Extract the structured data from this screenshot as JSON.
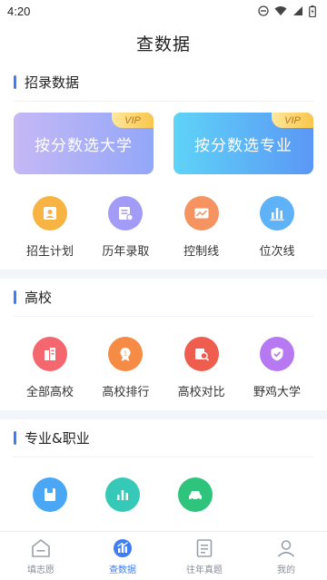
{
  "status_bar": {
    "time": "4:20"
  },
  "header": {
    "title": "查数据"
  },
  "sections": [
    {
      "title": "招录数据",
      "vip_cards": [
        {
          "label": "按分数选大学",
          "badge": "VIP"
        },
        {
          "label": "按分数选专业",
          "badge": "VIP"
        }
      ],
      "items": [
        {
          "label": "招生计划",
          "icon": "admission-plan-icon",
          "color": "#f8b443"
        },
        {
          "label": "历年录取",
          "icon": "admission-history-icon",
          "color": "#a39cf6"
        },
        {
          "label": "控制线",
          "icon": "control-line-icon",
          "color": "#f59460"
        },
        {
          "label": "位次线",
          "icon": "rank-line-icon",
          "color": "#5fb2f7"
        }
      ]
    },
    {
      "title": "高校",
      "items": [
        {
          "label": "全部高校",
          "icon": "all-universities-icon",
          "color": "#f5676e"
        },
        {
          "label": "高校排行",
          "icon": "university-ranking-icon",
          "color": "#f58b45"
        },
        {
          "label": "高校对比",
          "icon": "university-compare-icon",
          "color": "#ef5d4f"
        },
        {
          "label": "野鸡大学",
          "icon": "fake-university-icon",
          "color": "#b679f2"
        }
      ]
    },
    {
      "title": "专业&职业",
      "items": [
        {
          "label": "",
          "icon": "major-book-icon",
          "color": "#4aa7f5"
        },
        {
          "label": "",
          "icon": "major-stats-icon",
          "color": "#37c9b7"
        },
        {
          "label": "",
          "icon": "career-car-icon",
          "color": "#2ec47b"
        }
      ]
    }
  ],
  "tabbar": [
    {
      "label": "填志愿",
      "icon": "fill-application-icon",
      "active": false
    },
    {
      "label": "查数据",
      "icon": "query-data-icon",
      "active": true
    },
    {
      "label": "往年真题",
      "icon": "past-exams-icon",
      "active": false
    },
    {
      "label": "我的",
      "icon": "profile-icon",
      "active": false
    }
  ]
}
